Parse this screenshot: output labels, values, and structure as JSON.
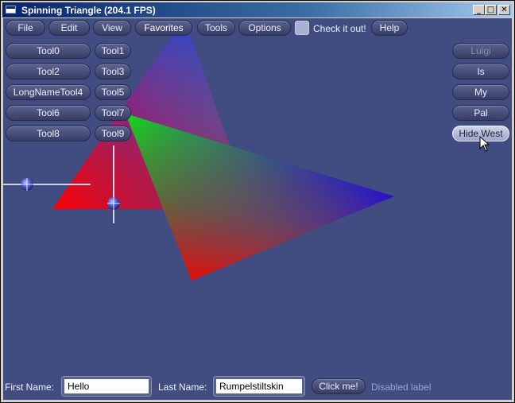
{
  "window": {
    "title": "Spinning Triangle (204.1 FPS)",
    "controls": {
      "minimize": "_",
      "maximize": "□",
      "close": "✕"
    }
  },
  "menubar": {
    "items": [
      "File",
      "Edit",
      "View",
      "Favorites",
      "Tools",
      "Options"
    ],
    "active_item": "Favorites",
    "checkbox_label": "Check it out!",
    "help": "Help"
  },
  "tool_buttons": [
    "Tool0",
    "Tool1",
    "Tool2",
    "Tool3",
    "LongNameTool4",
    "Tool5",
    "Tool6",
    "Tool7",
    "Tool8",
    "Tool9"
  ],
  "right_buttons": {
    "items": [
      "Luigi",
      "Is",
      "My",
      "Pal",
      "Hide West"
    ],
    "disabled": "Luigi",
    "hovered": "Hide West"
  },
  "form": {
    "first_name_label": "First Name:",
    "first_name_value": "Hello",
    "last_name_label": "Last Name:",
    "last_name_value": "Rumpelstiltskin",
    "click_button": "Click me!",
    "disabled_label": "Disabled label"
  },
  "colors": {
    "canvas_background": "#414c80",
    "button_face": "#4a5180",
    "titlebar_start": "#0a246a",
    "titlebar_end": "#a6caf0"
  },
  "icons": {
    "cursor": "arrow-cursor-icon",
    "app": "window-app-icon",
    "slider_knob": "sphere-knob-icon"
  }
}
